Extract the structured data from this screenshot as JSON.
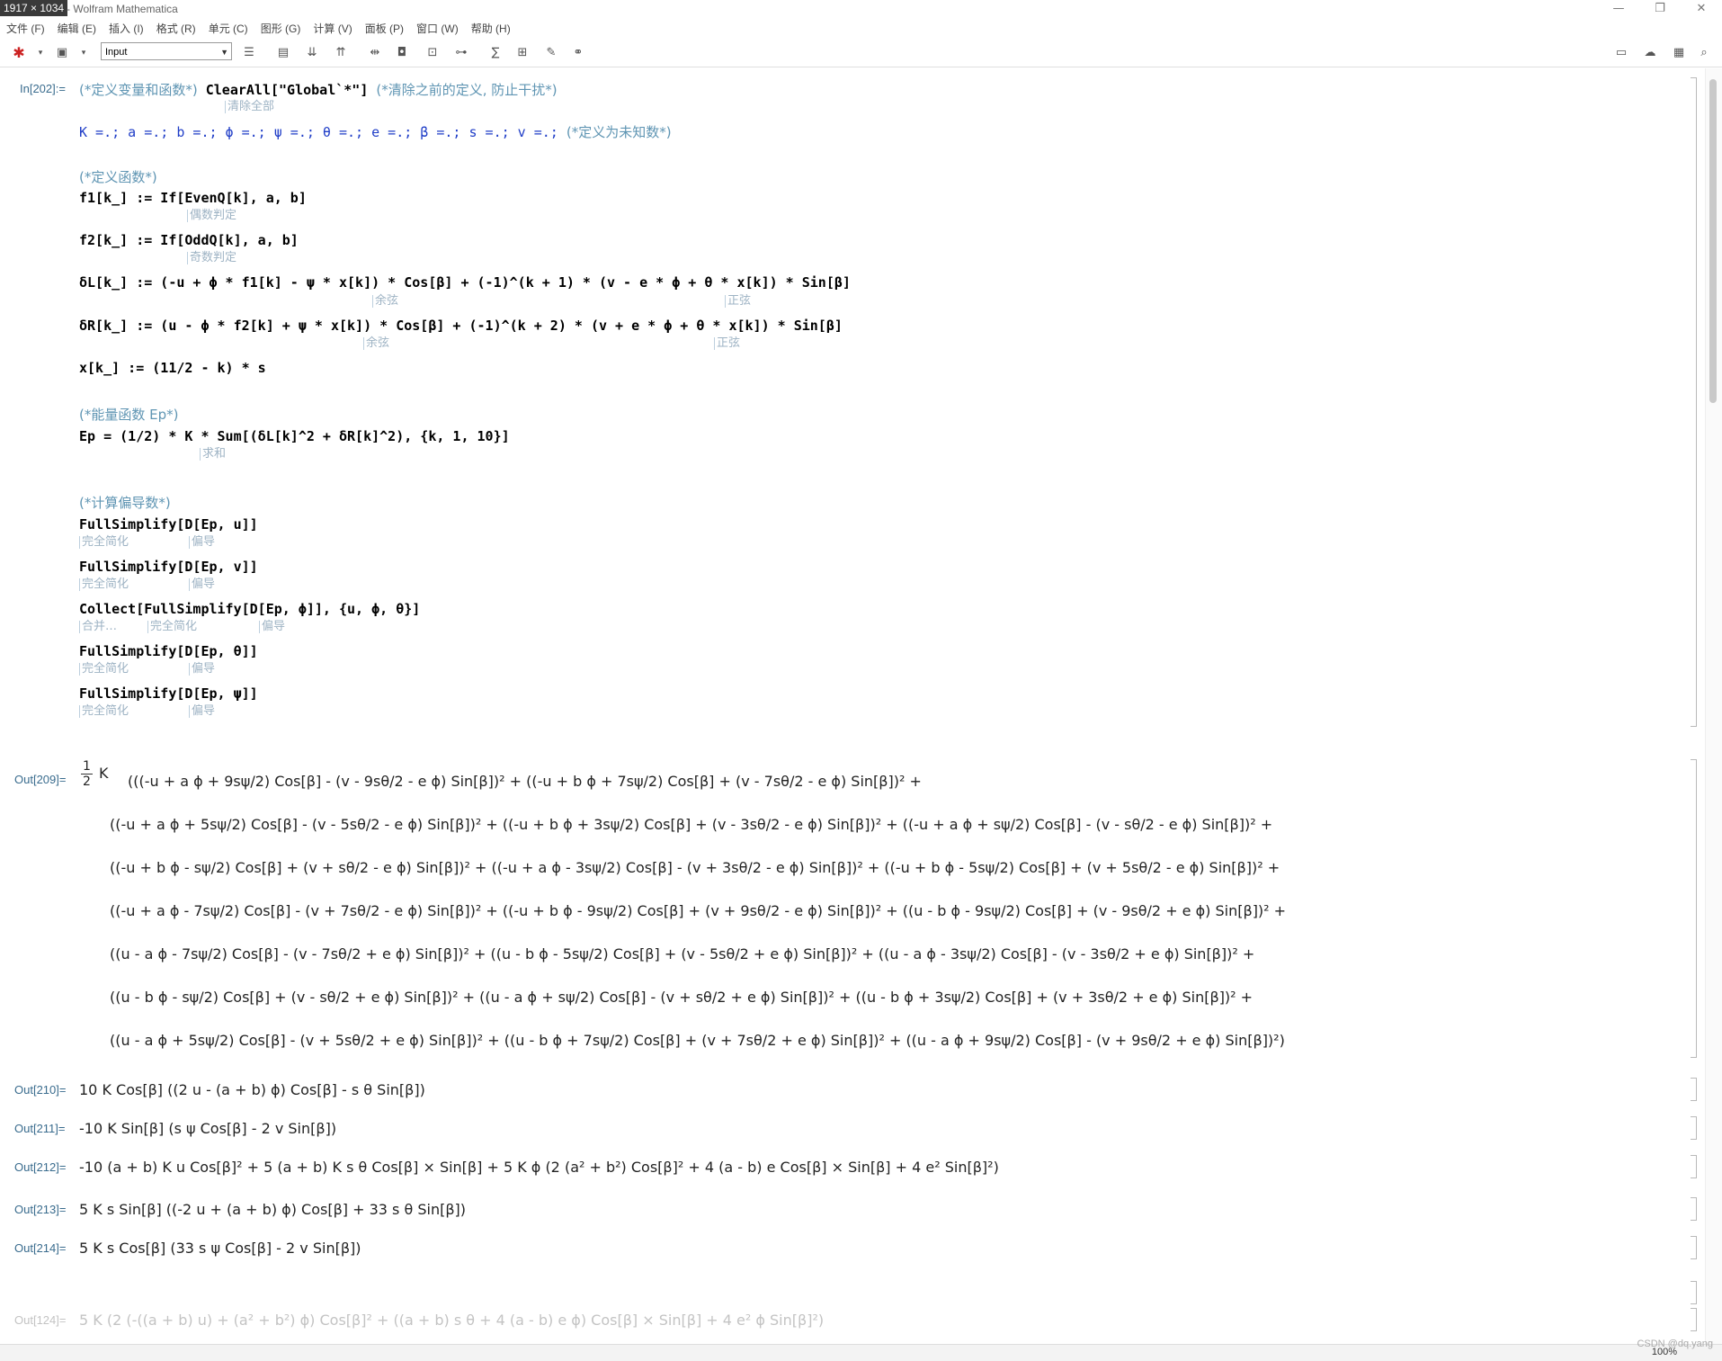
{
  "window": {
    "size_badge": "1917 × 1034",
    "title": "- Wolfram Mathematica",
    "minimize": "—",
    "restore": "❐",
    "close": "✕"
  },
  "menu": [
    "文件 (F)",
    "编辑 (E)",
    "插入 (I)",
    "格式 (R)",
    "单元 (C)",
    "图形 (G)",
    "计算 (V)",
    "面板 (P)",
    "窗口 (W)",
    "帮助 (H)"
  ],
  "toolbar": {
    "style_value": "Input"
  },
  "input": {
    "label": "In[202]:=",
    "line1_comment": "(*定义变量和函数*)",
    "line1_code": "ClearAll[\"Global`*\"]",
    "line1_comment2": "(*清除之前的定义, 防止干扰*)",
    "tip_clearall": "清除全部",
    "line2_code": "K =.; a =.; b =.; ϕ =.; ψ =.; θ =.; e =.; β =.; s =.; v =.;",
    "line2_comment": "(*定义为未知数*)",
    "comment_fn": "(*定义函数*)",
    "f1": "f1[k_] := If[EvenQ[k], a, b]",
    "tip_even": "偶数判定",
    "f2": "f2[k_] := If[OddQ[k], a, b]",
    "tip_odd": "奇数判定",
    "dL": "δL[k_] := (-u + ϕ * f1[k] - ψ * x[k]) * Cos[β] + (-1)^(k + 1) * (v - e * ϕ + θ * x[k]) * Sin[β]",
    "dR": "δR[k_] := (u - ϕ * f2[k] + ψ * x[k]) * Cos[β] + (-1)^(k + 2) * (v + e * ϕ + θ * x[k]) * Sin[β]",
    "tip_cos": "余弦",
    "tip_sin": "正弦",
    "x": "x[k_] := (11/2 - k) * s",
    "comment_ep": "(*能量函数 Ep*)",
    "ep": "Ep = (1/2) * K * Sum[(δL[k]^2 + δR[k]^2), {k, 1, 10}]",
    "tip_sum": "求和",
    "comment_deriv": "(*计算偏导数*)",
    "d1": "FullSimplify[D[Ep, u]]",
    "d2": "FullSimplify[D[Ep, v]]",
    "d3": "Collect[FullSimplify[D[Ep, ϕ]], {u, ϕ, θ}]",
    "d4": "FullSimplify[D[Ep, θ]]",
    "d5": "FullSimplify[D[Ep, ψ]]",
    "tip_fullsimplify": "完全简化",
    "tip_d": "偏导",
    "tip_collect": "合并…"
  },
  "outputs": {
    "o209_label": "Out[209]=",
    "o209_rows": [
      "(((-u + a ϕ + 9sψ/2) Cos[β] - (v - 9sθ/2 - e ϕ) Sin[β])² + ((-u + b ϕ + 7sψ/2) Cos[β] + (v - 7sθ/2 - e ϕ) Sin[β])² +",
      "((-u + a ϕ + 5sψ/2) Cos[β] - (v - 5sθ/2 - e ϕ) Sin[β])² + ((-u + b ϕ + 3sψ/2) Cos[β] + (v - 3sθ/2 - e ϕ) Sin[β])² + ((-u + a ϕ + sψ/2) Cos[β] - (v - sθ/2 - e ϕ) Sin[β])² +",
      "((-u + b ϕ - sψ/2) Cos[β] + (v + sθ/2 - e ϕ) Sin[β])² + ((-u + a ϕ - 3sψ/2) Cos[β] - (v + 3sθ/2 - e ϕ) Sin[β])² + ((-u + b ϕ - 5sψ/2) Cos[β] + (v + 5sθ/2 - e ϕ) Sin[β])² +",
      "((-u + a ϕ - 7sψ/2) Cos[β] - (v + 7sθ/2 - e ϕ) Sin[β])² + ((-u + b ϕ - 9sψ/2) Cos[β] + (v + 9sθ/2 - e ϕ) Sin[β])² + ((u - b ϕ - 9sψ/2) Cos[β] + (v - 9sθ/2 + e ϕ) Sin[β])² +",
      "((u - a ϕ - 7sψ/2) Cos[β] - (v - 7sθ/2 + e ϕ) Sin[β])² + ((u - b ϕ - 5sψ/2) Cos[β] + (v - 5sθ/2 + e ϕ) Sin[β])² + ((u - a ϕ - 3sψ/2) Cos[β] - (v - 3sθ/2 + e ϕ) Sin[β])² +",
      "((u - b ϕ - sψ/2) Cos[β] + (v - sθ/2 + e ϕ) Sin[β])² + ((u - a ϕ + sψ/2) Cos[β] - (v + sθ/2 + e ϕ) Sin[β])² + ((u - b ϕ + 3sψ/2) Cos[β] + (v + 3sθ/2 + e ϕ) Sin[β])² +",
      "((u - a ϕ + 5sψ/2) Cos[β] - (v + 5sθ/2 + e ϕ) Sin[β])² + ((u - b ϕ + 7sψ/2) Cos[β] + (v + 7sθ/2 + e ϕ) Sin[β])² + ((u - a ϕ + 9sψ/2) Cos[β] - (v + 9sθ/2 + e ϕ) Sin[β])²)"
    ],
    "o210_label": "Out[210]=",
    "o210": "10 K Cos[β] ((2 u - (a + b) ϕ) Cos[β] - s θ Sin[β])",
    "o211_label": "Out[211]=",
    "o211": "-10 K Sin[β] (s ψ Cos[β] - 2 v Sin[β])",
    "o212_label": "Out[212]=",
    "o212": "-10 (a + b) K u Cos[β]² + 5 (a + b) K s θ Cos[β] × Sin[β] + 5 K ϕ (2 (a² + b²) Cos[β]² + 4 (a - b) e Cos[β] × Sin[β] + 4 e² Sin[β]²)",
    "o213_label": "Out[213]=",
    "o213": "5 K s Sin[β] ((-2 u + (a + b) ϕ) Cos[β] + 33 s θ Sin[β])",
    "o214_label": "Out[214]=",
    "o214": "5 K s Cos[β] (33 s ψ Cos[β] - 2 v Sin[β])",
    "o124_label": "Out[124]=",
    "o124": "5 K (2 (-((a + b) u) + (a² + b²) ϕ) Cos[β]² + ((a + b) s θ + 4 (a - b) e ϕ) Cos[β] × Sin[β] + 4 e² ϕ Sin[β]²)"
  },
  "status": {
    "zoom": "100%"
  },
  "watermark": "CSDN @dq.yang"
}
